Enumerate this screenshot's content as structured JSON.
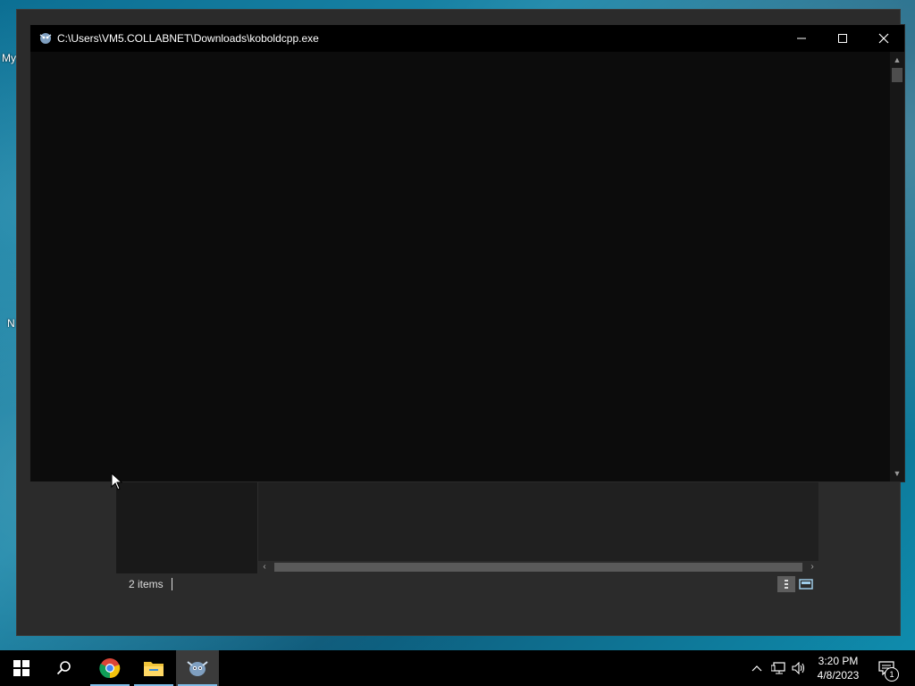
{
  "desktop": {
    "icon_labels": [
      "My",
      "N"
    ]
  },
  "explorer": {
    "status_items": "2 items"
  },
  "console": {
    "title": "C:\\Users\\VM5.COLLABNET\\Downloads\\koboldcpp.exe",
    "icon": "koboldcpp-app-icon",
    "controls": [
      "minimize-icon",
      "maximize-icon",
      "close-icon"
    ]
  },
  "taskbar": {
    "items": [
      {
        "name": "start",
        "icon": "windows-logo-icon"
      },
      {
        "name": "search",
        "icon": "search-icon"
      },
      {
        "name": "chrome",
        "icon": "chrome-icon"
      },
      {
        "name": "file-explorer",
        "icon": "folder-icon"
      },
      {
        "name": "koboldcpp",
        "icon": "koboldcpp-app-icon"
      }
    ],
    "tray": {
      "icons": [
        "chevron-up-icon",
        "network-icon",
        "volume-icon"
      ],
      "time": "3:20 PM",
      "date": "4/8/2023",
      "notifications_count": "1"
    }
  },
  "colors": {
    "console_bg": "#0c0c0c",
    "titlebar_bg": "#000000",
    "accent": "#7fbde8"
  }
}
